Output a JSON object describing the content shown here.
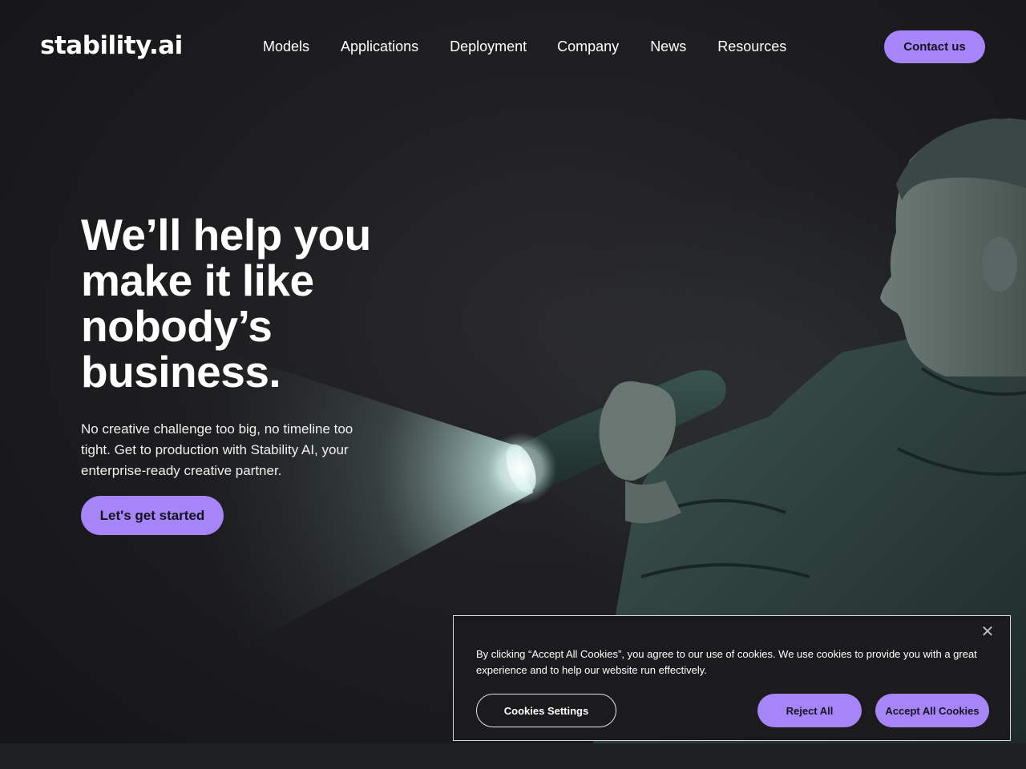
{
  "brand": {
    "logo_text": "stability.ai",
    "accent_color": "#a585f7"
  },
  "nav": {
    "items": [
      {
        "label": "Models"
      },
      {
        "label": "Applications"
      },
      {
        "label": "Deployment"
      },
      {
        "label": "Company"
      },
      {
        "label": "News"
      },
      {
        "label": "Resources"
      }
    ],
    "contact_label": "Contact us"
  },
  "hero": {
    "headline": "We’ll help you make it like nobody’s business.",
    "subtext": "No creative challenge too big, no timeline too tight. Get to production with Stability AI, your enterprise-ready creative partner.",
    "cta_label": "Let's get started",
    "illustration_icon": "person-with-flashlight"
  },
  "cookie_banner": {
    "message": "By clicking “Accept All Cookies”, you agree to our use of cookies. We use cookies to provide you with a great experience and to help our website run effectively.",
    "close_icon": "close-icon",
    "settings_label": "Cookies Settings",
    "reject_label": "Reject All",
    "accept_label": "Accept All Cookies"
  }
}
